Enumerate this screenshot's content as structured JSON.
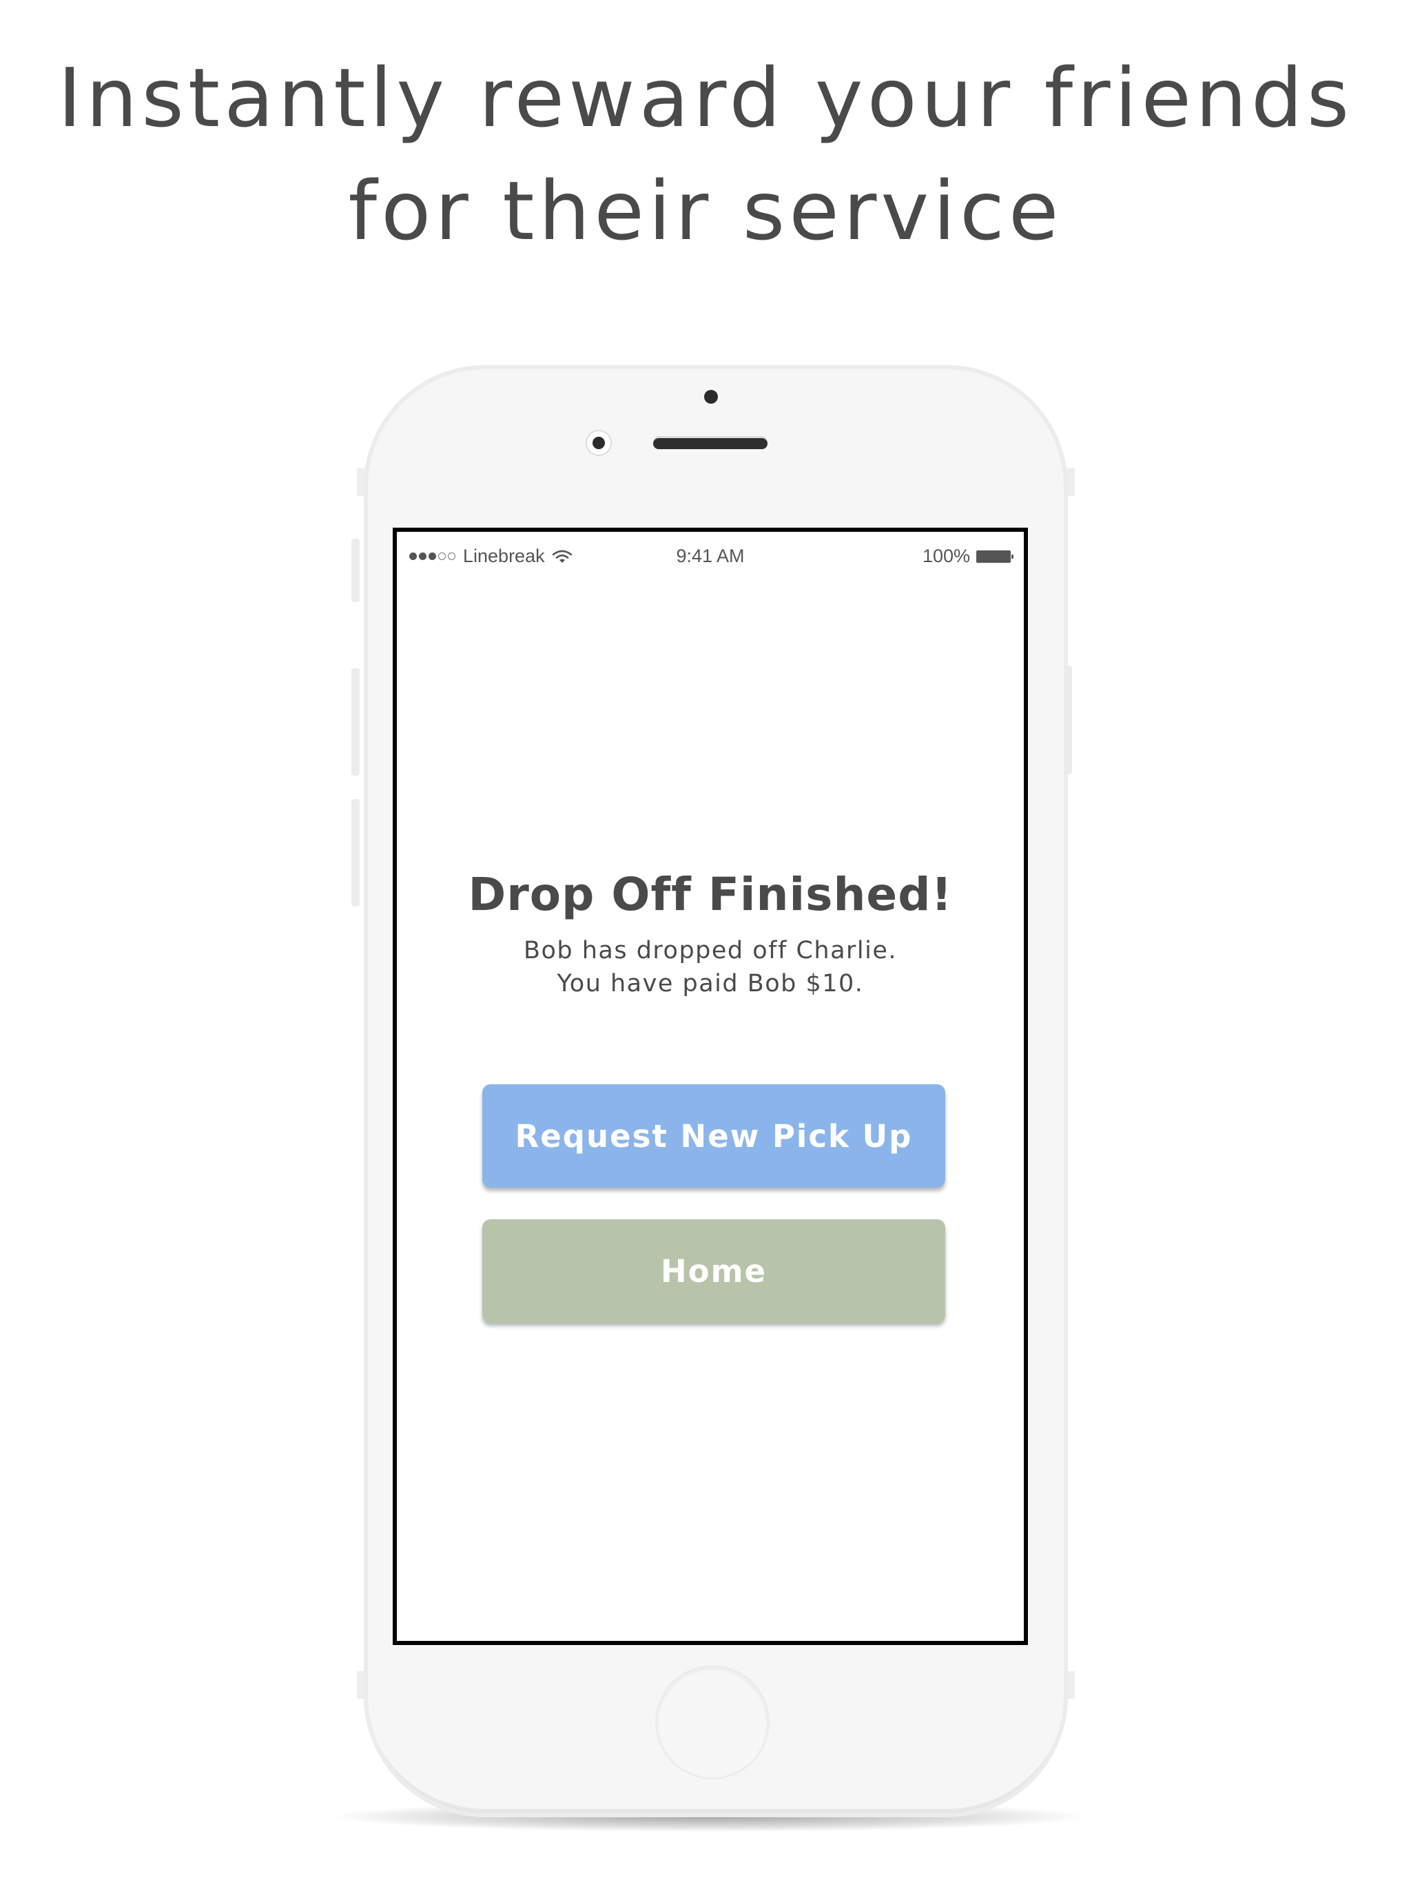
{
  "headline": {
    "line1": "Instantly reward your friends",
    "line2": "for their service"
  },
  "status_bar": {
    "signal_bars_filled": 3,
    "signal_bars_total": 5,
    "carrier": "Linebreak",
    "time": "9:41 AM",
    "battery": "100%"
  },
  "screen": {
    "title": "Drop Off Finished!",
    "message_line1": "Bob has dropped off Charlie.",
    "message_line2": "You have paid Bob $10.",
    "primary_button": "Request New Pick Up",
    "secondary_button": "Home"
  },
  "colors": {
    "primary_button": "#8bb5ea",
    "secondary_button": "#b7c4a9",
    "text": "#4a4a4a"
  }
}
